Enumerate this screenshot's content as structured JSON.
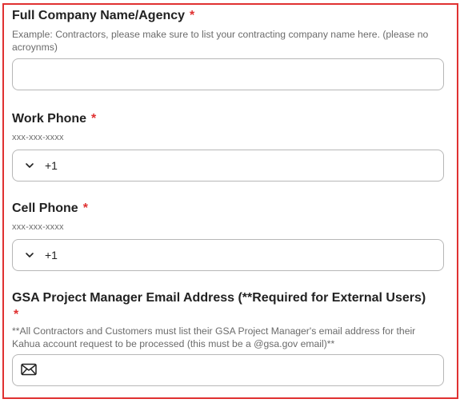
{
  "company": {
    "label": "Full Company Name/Agency",
    "required_mark": "*",
    "help": "Example: Contractors, please make sure to list your contracting company name here. (please no acroynms)",
    "value": ""
  },
  "work_phone": {
    "label": "Work Phone",
    "required_mark": "*",
    "format_hint": "xxx-xxx-xxxx",
    "country_code": "+1"
  },
  "cell_phone": {
    "label": "Cell Phone",
    "required_mark": "*",
    "format_hint": "xxx-xxx-xxxx",
    "country_code": "+1"
  },
  "gsa_email": {
    "label": "GSA Project Manager Email Address (**Required for External Users)",
    "required_mark": "*",
    "help": "**All Contractors and Customers must list their GSA Project Manager's email address for their Kahua account request to be processed (this must be a @gsa.gov email)**",
    "value": ""
  },
  "colors": {
    "highlight_border": "#e03131",
    "required": "#e03131",
    "label_text": "#222222",
    "help_text": "#6b6b6b",
    "input_border": "#b7b7b7"
  },
  "icons": {
    "chevron": "chevron-down-icon",
    "mail": "mail-icon"
  }
}
